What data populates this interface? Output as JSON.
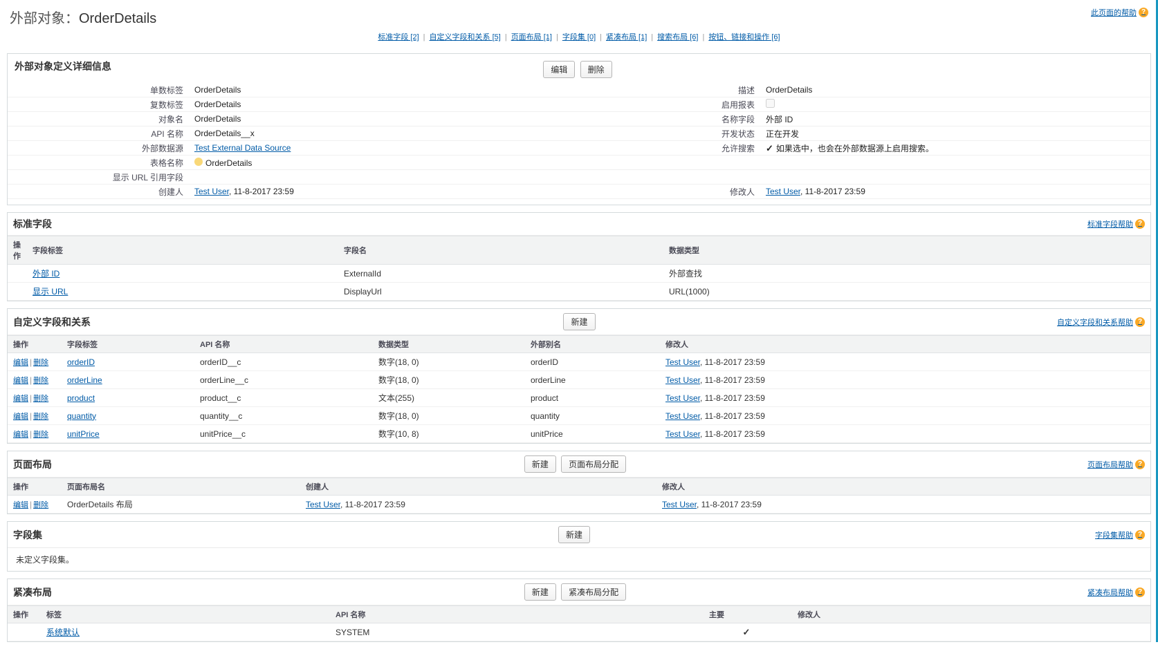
{
  "header": {
    "page_title_prefix": "外部对象：",
    "page_title": "OrderDetails",
    "help_link": "此页面的帮助"
  },
  "anchors": [
    {
      "label": "标准字段",
      "count": "[2]"
    },
    {
      "label": "自定义字段和关系",
      "count": "[5]"
    },
    {
      "label": "页面布局",
      "count": "[1]"
    },
    {
      "label": "字段集",
      "count": "[0]"
    },
    {
      "label": "紧凑布局",
      "count": "[1]"
    },
    {
      "label": "搜索布局",
      "count": "[6]"
    },
    {
      "label": "按钮、链接和操作",
      "count": "[6]"
    }
  ],
  "detail": {
    "title": "外部对象定义详细信息",
    "btn_edit": "编辑",
    "btn_delete": "删除",
    "left": [
      {
        "label": "单数标签",
        "value": "OrderDetails"
      },
      {
        "label": "复数标签",
        "value": "OrderDetails"
      },
      {
        "label": "对象名",
        "value": "OrderDetails"
      },
      {
        "label": "API 名称",
        "value": "OrderDetails__x"
      },
      {
        "label": "外部数据源",
        "value": "Test External Data Source",
        "link": true
      },
      {
        "label": "表格名称",
        "value": "OrderDetails",
        "info": true
      },
      {
        "label": "显示 URL 引用字段",
        "value": ""
      },
      {
        "label": "创建人",
        "value": "Test User",
        "link": true,
        "suffix": ", 11-8-2017 23:59"
      }
    ],
    "right": [
      {
        "label": "描述",
        "value": "OrderDetails"
      },
      {
        "label": "启用报表",
        "value": "",
        "checkbox": true
      },
      {
        "label": "名称字段",
        "value": "外部 ID"
      },
      {
        "label": "开发状态",
        "value": "正在开发"
      },
      {
        "label": "允许搜索",
        "value": "如果选中，也会在外部数据源上启用搜索。",
        "checked": true
      },
      {
        "label": "",
        "value": ""
      },
      {
        "label": "",
        "value": ""
      },
      {
        "label": "修改人",
        "value": "Test User",
        "link": true,
        "suffix": ", 11-8-2017 23:59"
      }
    ]
  },
  "std_fields": {
    "title": "标准字段",
    "help": "标准字段帮助",
    "cols": [
      "操作",
      "字段标签",
      "字段名",
      "数据类型"
    ],
    "rows": [
      {
        "label": "外部 ID",
        "name": "ExternalId",
        "type": "外部查找"
      },
      {
        "label": "显示 URL",
        "name": "DisplayUrl",
        "type": "URL(1000)"
      }
    ]
  },
  "custom_fields": {
    "title": "自定义字段和关系",
    "help": "自定义字段和关系帮助",
    "btn_new": "新建",
    "cols": [
      "操作",
      "字段标签",
      "API 名称",
      "数据类型",
      "外部别名",
      "修改人"
    ],
    "edit": "编辑",
    "del": "删除",
    "rows": [
      {
        "label": "orderID",
        "api": "orderID__c",
        "type": "数字(18, 0)",
        "alias": "orderID",
        "user": "Test User",
        "ts": ", 11-8-2017 23:59"
      },
      {
        "label": "orderLine",
        "api": "orderLine__c",
        "type": "数字(18, 0)",
        "alias": "orderLine",
        "user": "Test User",
        "ts": ", 11-8-2017 23:59"
      },
      {
        "label": "product",
        "api": "product__c",
        "type": "文本(255)",
        "alias": "product",
        "user": "Test User",
        "ts": ", 11-8-2017 23:59"
      },
      {
        "label": "quantity",
        "api": "quantity__c",
        "type": "数字(18, 0)",
        "alias": "quantity",
        "user": "Test User",
        "ts": ", 11-8-2017 23:59"
      },
      {
        "label": "unitPrice",
        "api": "unitPrice__c",
        "type": "数字(10, 8)",
        "alias": "unitPrice",
        "user": "Test User",
        "ts": ", 11-8-2017 23:59"
      }
    ]
  },
  "page_layouts": {
    "title": "页面布局",
    "help": "页面布局帮助",
    "btn_new": "新建",
    "btn_assign": "页面布局分配",
    "cols": [
      "操作",
      "页面布局名",
      "创建人",
      "修改人"
    ],
    "edit": "编辑",
    "del": "删除",
    "rows": [
      {
        "name": "OrderDetails 布局",
        "creator": "Test User",
        "cts": ", 11-8-2017 23:59",
        "mod": "Test User",
        "mts": ", 11-8-2017 23:59"
      }
    ]
  },
  "fieldsets": {
    "title": "字段集",
    "help": "字段集帮助",
    "btn_new": "新建",
    "empty": "未定义字段集。"
  },
  "compact": {
    "title": "紧凑布局",
    "help": "紧凑布局帮助",
    "btn_new": "新建",
    "btn_assign": "紧凑布局分配",
    "cols": [
      "操作",
      "标签",
      "API 名称",
      "主要",
      "修改人"
    ],
    "rows": [
      {
        "label": "系统默认",
        "api": "SYSTEM",
        "primary": true
      }
    ]
  }
}
